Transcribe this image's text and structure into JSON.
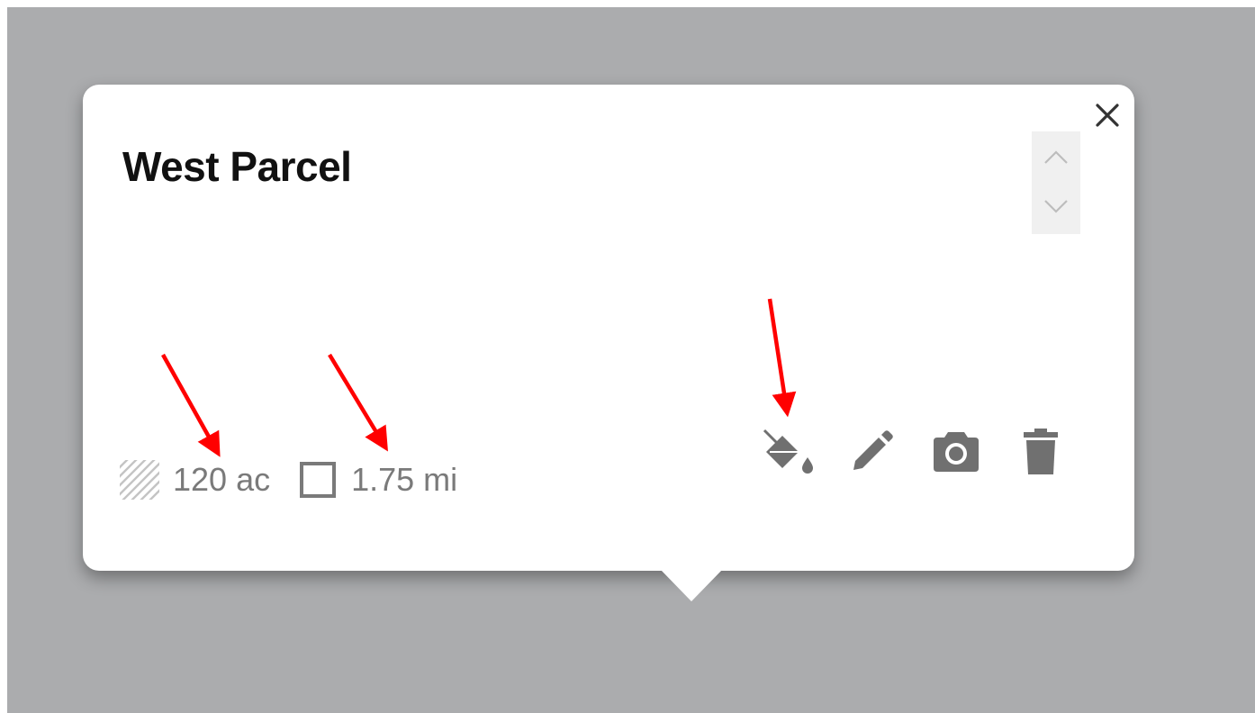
{
  "popup": {
    "title": "West Parcel",
    "stats": {
      "area": {
        "value": "120 ac",
        "icon": "hatched-area-icon"
      },
      "perimeter": {
        "value": "1.75 mi",
        "icon": "square-outline-icon"
      }
    },
    "controls": {
      "close_icon": "close-icon",
      "prev_icon": "chevron-up-icon",
      "next_icon": "chevron-down-icon"
    },
    "actions": [
      {
        "name": "fill-color",
        "icon": "paint-bucket-icon"
      },
      {
        "name": "edit",
        "icon": "pencil-icon"
      },
      {
        "name": "photo",
        "icon": "camera-icon"
      },
      {
        "name": "delete",
        "icon": "trash-icon"
      }
    ]
  },
  "colors": {
    "map_background": "#abacae",
    "popup_background": "#ffffff",
    "title_text": "#111111",
    "stat_text": "#7a7a7a",
    "action_icon": "#707070",
    "annotation_arrow": "#ff0000"
  }
}
